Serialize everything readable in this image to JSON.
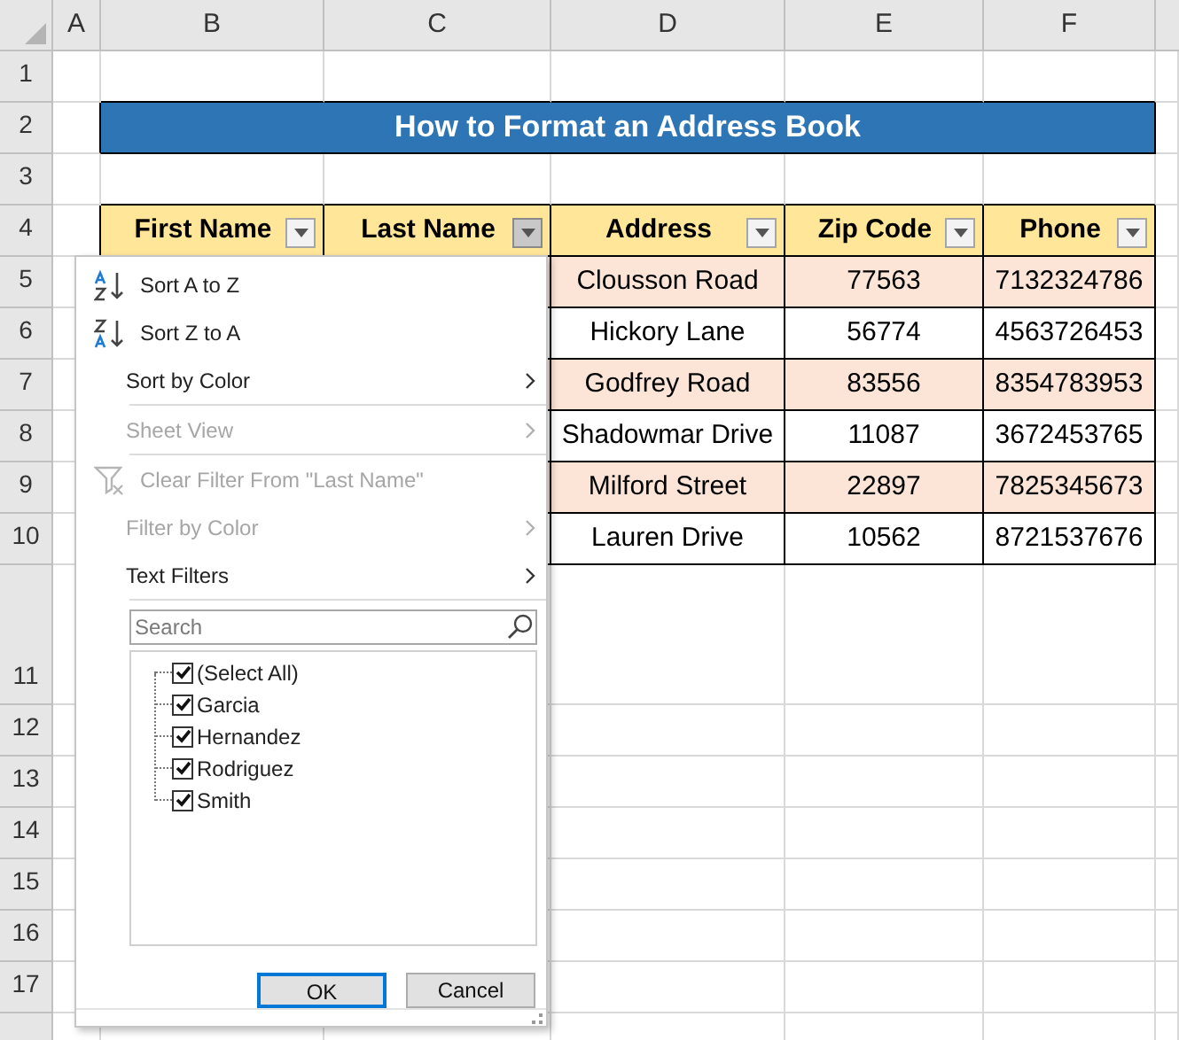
{
  "columns": [
    "A",
    "B",
    "C",
    "D",
    "E",
    "F"
  ],
  "row_numbers": [
    "1",
    "2",
    "3",
    "4",
    "5",
    "6",
    "7",
    "8",
    "9",
    "10",
    "11",
    "12",
    "13",
    "14",
    "15",
    "16",
    "17"
  ],
  "title": "How to Format an Address Book",
  "table": {
    "headers": [
      {
        "label": "First Name",
        "filter_selected": false
      },
      {
        "label": "Last Name",
        "filter_selected": true
      },
      {
        "label": "Address",
        "filter_selected": false
      },
      {
        "label": "Zip Code",
        "filter_selected": false
      },
      {
        "label": "Phone",
        "filter_selected": false
      }
    ],
    "rows": [
      {
        "shaded": true,
        "cells": [
          "Clousson Road",
          "77563",
          "7132324786"
        ]
      },
      {
        "shaded": false,
        "cells": [
          "Hickory Lane",
          "56774",
          "4563726453"
        ]
      },
      {
        "shaded": true,
        "cells": [
          "Godfrey Road",
          "83556",
          "8354783953"
        ]
      },
      {
        "shaded": false,
        "cells": [
          "Shadowmar Drive",
          "11087",
          "3672453765"
        ]
      },
      {
        "shaded": true,
        "cells": [
          "Milford Street",
          "22897",
          "7825345673"
        ]
      },
      {
        "shaded": false,
        "cells": [
          "Lauren Drive",
          "10562",
          "8721537676"
        ]
      }
    ]
  },
  "filter_menu": {
    "sections": [
      [
        {
          "label": "Sort A to Z",
          "kind": "sort-ascending",
          "disabled": false,
          "submenu": false
        },
        {
          "label": "Sort Z to A",
          "kind": "sort-descending",
          "disabled": false,
          "submenu": false
        },
        {
          "label": "Sort by Color",
          "kind": "plain",
          "disabled": false,
          "submenu": true
        }
      ],
      [
        {
          "label": "Sheet View",
          "kind": "plain",
          "disabled": true,
          "submenu": true
        }
      ],
      [
        {
          "label": "Clear Filter From \"Last Name\"",
          "kind": "clear-filter",
          "disabled": true,
          "submenu": false
        },
        {
          "label": "Filter by Color",
          "kind": "plain",
          "disabled": true,
          "submenu": true
        },
        {
          "label": "Text Filters",
          "kind": "plain",
          "disabled": false,
          "submenu": true
        }
      ]
    ],
    "search": {
      "placeholder": "Search"
    },
    "values": [
      {
        "label": "(Select All)",
        "checked": true
      },
      {
        "label": "Garcia",
        "checked": true
      },
      {
        "label": "Hernandez",
        "checked": true
      },
      {
        "label": "Rodriguez",
        "checked": true
      },
      {
        "label": "Smith",
        "checked": true
      }
    ],
    "buttons": [
      {
        "label": "OK",
        "kind": "default"
      },
      {
        "label": "Cancel",
        "kind": "plain"
      }
    ]
  }
}
